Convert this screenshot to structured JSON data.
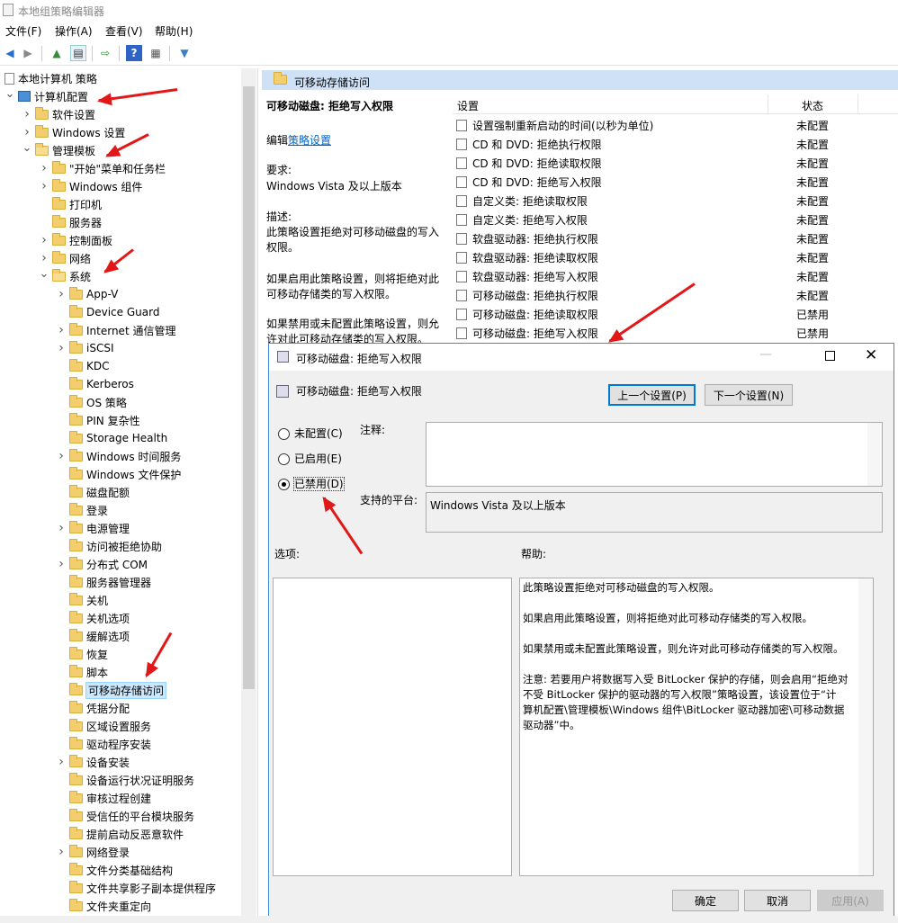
{
  "window": {
    "title": "本地组策略编辑器"
  },
  "menu": [
    "文件(F)",
    "操作(A)",
    "查看(V)",
    "帮助(H)"
  ],
  "tree": {
    "root": "本地计算机 策略",
    "items": [
      {
        "label": "计算机配置",
        "level": 0,
        "arrow": "down",
        "icon": "computer"
      },
      {
        "label": "软件设置",
        "level": 1,
        "arrow": "right"
      },
      {
        "label": "Windows 设置",
        "level": 1,
        "arrow": "right"
      },
      {
        "label": "管理模板",
        "level": 1,
        "arrow": "down"
      },
      {
        "label": "\"开始\"菜单和任务栏",
        "level": 2,
        "arrow": "right"
      },
      {
        "label": "Windows 组件",
        "level": 2,
        "arrow": "right"
      },
      {
        "label": "打印机",
        "level": 2,
        "arrow": ""
      },
      {
        "label": "服务器",
        "level": 2,
        "arrow": ""
      },
      {
        "label": "控制面板",
        "level": 2,
        "arrow": "right"
      },
      {
        "label": "网络",
        "level": 2,
        "arrow": "right"
      },
      {
        "label": "系统",
        "level": 2,
        "arrow": "down"
      },
      {
        "label": "App-V",
        "level": 3,
        "arrow": "right"
      },
      {
        "label": "Device Guard",
        "level": 3,
        "arrow": ""
      },
      {
        "label": "Internet 通信管理",
        "level": 3,
        "arrow": "right"
      },
      {
        "label": "iSCSI",
        "level": 3,
        "arrow": "right"
      },
      {
        "label": "KDC",
        "level": 3,
        "arrow": ""
      },
      {
        "label": "Kerberos",
        "level": 3,
        "arrow": ""
      },
      {
        "label": "OS 策略",
        "level": 3,
        "arrow": ""
      },
      {
        "label": "PIN 复杂性",
        "level": 3,
        "arrow": ""
      },
      {
        "label": "Storage Health",
        "level": 3,
        "arrow": ""
      },
      {
        "label": "Windows 时间服务",
        "level": 3,
        "arrow": "right"
      },
      {
        "label": "Windows 文件保护",
        "level": 3,
        "arrow": ""
      },
      {
        "label": "磁盘配额",
        "level": 3,
        "arrow": ""
      },
      {
        "label": "登录",
        "level": 3,
        "arrow": ""
      },
      {
        "label": "电源管理",
        "level": 3,
        "arrow": "right"
      },
      {
        "label": "访问被拒绝协助",
        "level": 3,
        "arrow": ""
      },
      {
        "label": "分布式 COM",
        "level": 3,
        "arrow": "right"
      },
      {
        "label": "服务器管理器",
        "level": 3,
        "arrow": ""
      },
      {
        "label": "关机",
        "level": 3,
        "arrow": ""
      },
      {
        "label": "关机选项",
        "level": 3,
        "arrow": ""
      },
      {
        "label": "缓解选项",
        "level": 3,
        "arrow": ""
      },
      {
        "label": "恢复",
        "level": 3,
        "arrow": ""
      },
      {
        "label": "脚本",
        "level": 3,
        "arrow": ""
      },
      {
        "label": "可移动存储访问",
        "level": 3,
        "arrow": "",
        "selected": true
      },
      {
        "label": "凭据分配",
        "level": 3,
        "arrow": ""
      },
      {
        "label": "区域设置服务",
        "level": 3,
        "arrow": ""
      },
      {
        "label": "驱动程序安装",
        "level": 3,
        "arrow": ""
      },
      {
        "label": "设备安装",
        "level": 3,
        "arrow": "right"
      },
      {
        "label": "设备运行状况证明服务",
        "level": 3,
        "arrow": ""
      },
      {
        "label": "审核过程创建",
        "level": 3,
        "arrow": ""
      },
      {
        "label": "受信任的平台模块服务",
        "level": 3,
        "arrow": ""
      },
      {
        "label": "提前启动反恶意软件",
        "level": 3,
        "arrow": ""
      },
      {
        "label": "网络登录",
        "level": 3,
        "arrow": "right"
      },
      {
        "label": "文件分类基础结构",
        "level": 3,
        "arrow": ""
      },
      {
        "label": "文件共享影子副本提供程序",
        "level": 3,
        "arrow": ""
      },
      {
        "label": "文件夹重定向",
        "level": 3,
        "arrow": ""
      }
    ]
  },
  "right": {
    "header": "可移动存储访问",
    "desc": {
      "title": "可移动磁盘: 拒绝写入权限",
      "edit_prefix": "编辑",
      "edit_link": "策略设置",
      "req_label": "要求:",
      "req_value": "Windows Vista 及以上版本",
      "desc_label": "描述:",
      "d1a": "此策略设置拒绝对可移动磁盘的写入",
      "d1b": "权限。",
      "d2a": "如果启用此策略设置，则将拒绝对此",
      "d2b": "可移动存储类的写入权限。",
      "d3a": "如果禁用或未配置此策略设置，则允",
      "d3b": "许对此可移动存储类的写入权限。"
    },
    "col_setting": "设置",
    "col_state": "状态",
    "rows": [
      {
        "name": "设置强制重新启动的时间(以秒为单位)",
        "state": "未配置"
      },
      {
        "name": "CD 和 DVD: 拒绝执行权限",
        "state": "未配置"
      },
      {
        "name": "CD 和 DVD: 拒绝读取权限",
        "state": "未配置"
      },
      {
        "name": "CD 和 DVD: 拒绝写入权限",
        "state": "未配置"
      },
      {
        "name": "自定义类: 拒绝读取权限",
        "state": "未配置"
      },
      {
        "name": "自定义类: 拒绝写入权限",
        "state": "未配置"
      },
      {
        "name": "软盘驱动器: 拒绝执行权限",
        "state": "未配置"
      },
      {
        "name": "软盘驱动器: 拒绝读取权限",
        "state": "未配置"
      },
      {
        "name": "软盘驱动器: 拒绝写入权限",
        "state": "未配置"
      },
      {
        "name": "可移动磁盘: 拒绝执行权限",
        "state": "未配置"
      },
      {
        "name": "可移动磁盘: 拒绝读取权限",
        "state": "已禁用"
      },
      {
        "name": "可移动磁盘: 拒绝写入权限",
        "state": "已禁用"
      }
    ]
  },
  "dialog": {
    "title": "可移动磁盘: 拒绝写入权限",
    "setting_name": "可移动磁盘: 拒绝写入权限",
    "prev_btn": "上一个设置(P)",
    "next_btn": "下一个设置(N)",
    "opt_unconfigured": "未配置(C)",
    "opt_enabled": "已启用(E)",
    "opt_disabled": "已禁用(D)",
    "comment_label": "注释:",
    "platform_label": "支持的平台:",
    "platform_value": "Windows Vista 及以上版本",
    "options_label": "选项:",
    "help_label": "帮助:",
    "help_p1": "此策略设置拒绝对可移动磁盘的写入权限。",
    "help_p2": "如果启用此策略设置，则将拒绝对此可移动存储类的写入权限。",
    "help_p3": "如果禁用或未配置此策略设置，则允许对此可移动存储类的写入权限。",
    "help_p4a": "注意: 若要用户将数据写入受 BitLocker 保护的存储，则会启用“拒绝对",
    "help_p4b": "不受 BitLocker 保护的驱动器的写入权限”策略设置，该设置位于“计",
    "help_p4c": "算机配置\\管理模板\\Windows 组件\\BitLocker 驱动器加密\\可移动数据",
    "help_p4d": "驱动器”中。",
    "ok_btn": "确定",
    "cancel_btn": "取消",
    "apply_btn": "应用(A)"
  }
}
